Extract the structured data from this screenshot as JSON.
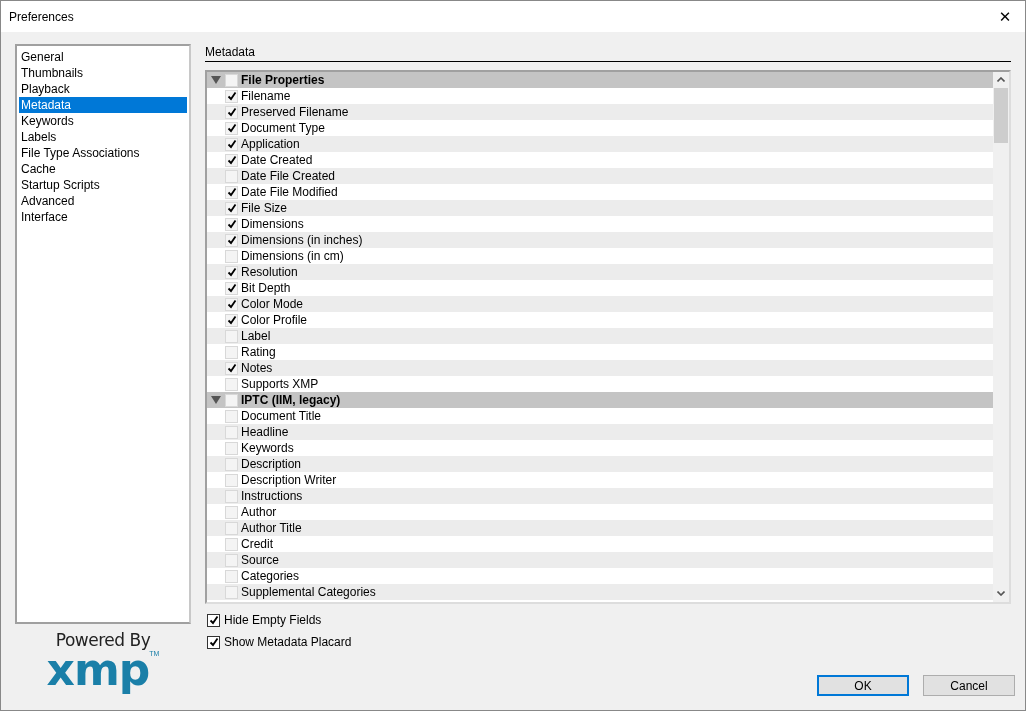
{
  "window": {
    "title": "Preferences",
    "close": "✕"
  },
  "sidebar": {
    "items": [
      {
        "label": "General",
        "selected": false
      },
      {
        "label": "Thumbnails",
        "selected": false
      },
      {
        "label": "Playback",
        "selected": false
      },
      {
        "label": "Metadata",
        "selected": true
      },
      {
        "label": "Keywords",
        "selected": false
      },
      {
        "label": "Labels",
        "selected": false
      },
      {
        "label": "File Type Associations",
        "selected": false
      },
      {
        "label": "Cache",
        "selected": false
      },
      {
        "label": "Startup Scripts",
        "selected": false
      },
      {
        "label": "Advanced",
        "selected": false
      },
      {
        "label": "Interface",
        "selected": false
      }
    ]
  },
  "logo": {
    "caption": "Powered By",
    "mark": "xmp",
    "trademark": "TM"
  },
  "panel": {
    "title": "Metadata"
  },
  "sections": [
    {
      "title": "File Properties",
      "expanded": true,
      "checked": false,
      "items": [
        {
          "label": "Filename",
          "checked": true
        },
        {
          "label": "Preserved Filename",
          "checked": true
        },
        {
          "label": "Document Type",
          "checked": true
        },
        {
          "label": "Application",
          "checked": true
        },
        {
          "label": "Date Created",
          "checked": true
        },
        {
          "label": "Date File Created",
          "checked": false
        },
        {
          "label": "Date File Modified",
          "checked": true
        },
        {
          "label": "File Size",
          "checked": true
        },
        {
          "label": "Dimensions",
          "checked": true
        },
        {
          "label": "Dimensions (in inches)",
          "checked": true
        },
        {
          "label": "Dimensions (in cm)",
          "checked": false
        },
        {
          "label": "Resolution",
          "checked": true
        },
        {
          "label": "Bit Depth",
          "checked": true
        },
        {
          "label": "Color Mode",
          "checked": true
        },
        {
          "label": "Color Profile",
          "checked": true
        },
        {
          "label": "Label",
          "checked": false
        },
        {
          "label": "Rating",
          "checked": false
        },
        {
          "label": "Notes",
          "checked": true
        },
        {
          "label": "Supports XMP",
          "checked": false
        }
      ]
    },
    {
      "title": "IPTC (IIM, legacy)",
      "expanded": true,
      "checked": false,
      "items": [
        {
          "label": "Document Title",
          "checked": false
        },
        {
          "label": "Headline",
          "checked": false
        },
        {
          "label": "Keywords",
          "checked": false
        },
        {
          "label": "Description",
          "checked": false
        },
        {
          "label": "Description Writer",
          "checked": false
        },
        {
          "label": "Instructions",
          "checked": false
        },
        {
          "label": "Author",
          "checked": false
        },
        {
          "label": "Author Title",
          "checked": false
        },
        {
          "label": "Credit",
          "checked": false
        },
        {
          "label": "Source",
          "checked": false
        },
        {
          "label": "Categories",
          "checked": false
        },
        {
          "label": "Supplemental Categories",
          "checked": false
        }
      ]
    }
  ],
  "options": [
    {
      "label": "Hide Empty Fields",
      "checked": true
    },
    {
      "label": "Show Metadata Placard",
      "checked": true
    }
  ],
  "buttons": [
    {
      "label": "OK",
      "default": true
    },
    {
      "label": "Cancel",
      "default": false
    }
  ]
}
